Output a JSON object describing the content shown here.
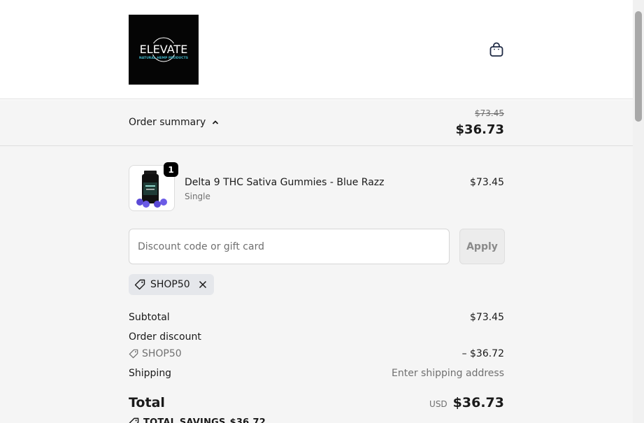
{
  "header": {
    "logo_text": "ELEVATE",
    "logo_tagline": "NATURAL HEMP PRODUCTS",
    "cart_icon": "shopping-bag-icon"
  },
  "summary_bar": {
    "toggle_label": "Order summary",
    "toggle_icon": "chevron-up-icon",
    "original_price": "$73.45",
    "total": "$36.73"
  },
  "product": {
    "quantity": "1",
    "name": "Delta 9 THC Sativa Gummies - Blue Razz",
    "variant": "Single",
    "price": "$73.45"
  },
  "discount": {
    "placeholder": "Discount code or gift card",
    "value": "",
    "apply_label": "Apply",
    "applied_code": "SHOP50"
  },
  "totals": {
    "subtotal_label": "Subtotal",
    "subtotal_value": "$73.45",
    "order_discount_label": "Order discount",
    "discount_code": "SHOP50",
    "discount_value": "– $36.72",
    "shipping_label": "Shipping",
    "shipping_value": "Enter shipping address",
    "total_label": "Total",
    "currency": "USD",
    "total_value": "$36.73",
    "savings_label": "TOTAL SAVINGS",
    "savings_value": "$36.72"
  },
  "colors": {
    "accent_teal": "#3fb6c9",
    "summary_bg": "#f5f5f5",
    "text": "#1a1a1a",
    "muted_text": "#707070"
  }
}
